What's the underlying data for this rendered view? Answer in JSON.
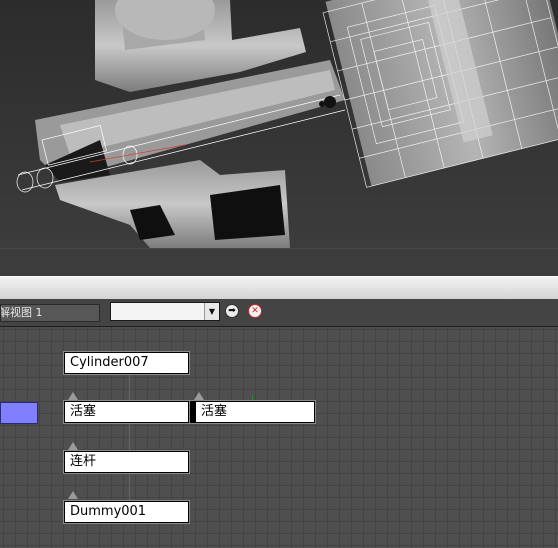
{
  "schematic": {
    "view_name": "解视图 1",
    "name_filter": {
      "value": "",
      "arrow": "▼"
    },
    "go_icon": "➡",
    "close_icon": "✕",
    "nodes": [
      {
        "label": "Cylinder007"
      },
      {
        "label": "活塞"
      },
      {
        "label": "活塞"
      },
      {
        "label": "连杆"
      },
      {
        "label": "Dummy001"
      }
    ]
  },
  "colors": {
    "selected_node": "#8080ff",
    "link": "#2f8a2f",
    "close_icon": "#c42a2a"
  }
}
